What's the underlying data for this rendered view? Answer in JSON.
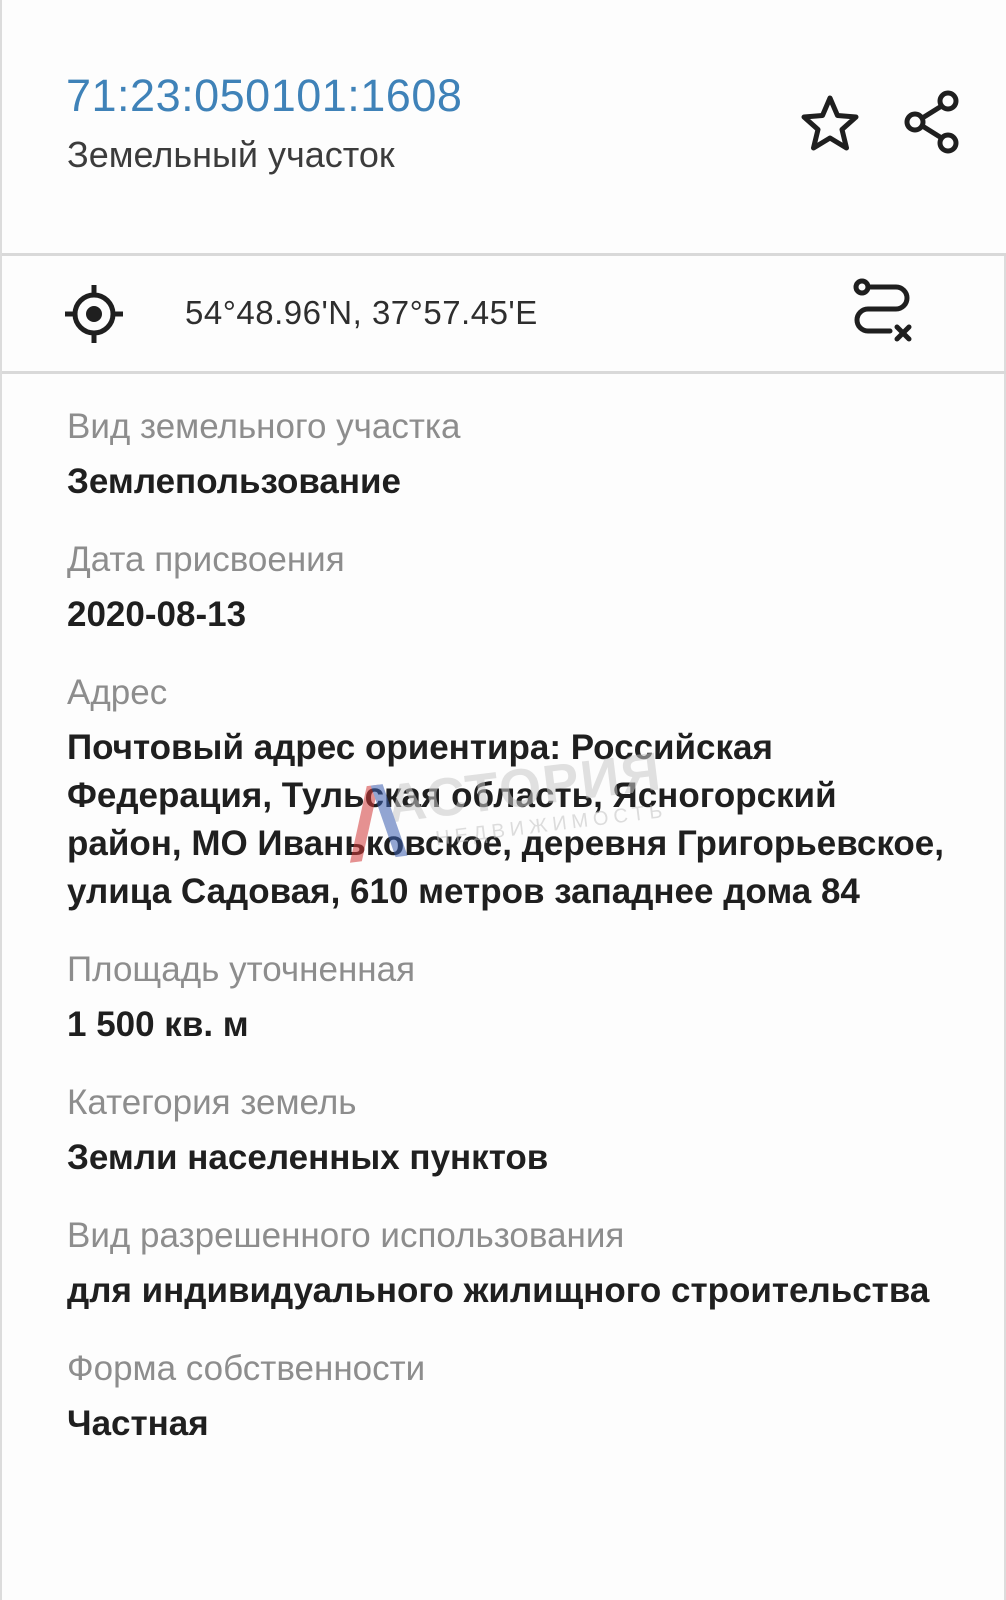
{
  "header": {
    "cadastral_number": "71:23:050101:1608",
    "object_type": "Земельный участок",
    "favorite_icon": "star-outline-icon",
    "share_icon": "share-icon"
  },
  "location": {
    "coordinates": "54°48.96'N, 37°57.45'E",
    "locate_icon": "crosshair-icon",
    "route_icon": "route-icon"
  },
  "fields": [
    {
      "label": "Вид земельного участка",
      "value": "Землепользование"
    },
    {
      "label": "Дата присвоения",
      "value": "2020-08-13"
    },
    {
      "label": "Адрес",
      "value": "Почтовый адрес ориентира: Российская Федерация, Тульская область, Ясногорский район, МО Иваньковское, деревня Григорьевское, улица Садовая, 610 метров западнее дома 84"
    },
    {
      "label": "Площадь уточненная",
      "value": "1 500 кв. м"
    },
    {
      "label": "Категория земель",
      "value": "Земли населенных пунктов"
    },
    {
      "label": "Вид разрешенного использования",
      "value": "для индивидуального жилищного строительства"
    },
    {
      "label": "Форма собственности",
      "value": "Частная"
    }
  ],
  "watermark": {
    "brand": "АСТОРИЯ",
    "tagline": "НЕДВИЖИМОСТЬ"
  },
  "colors": {
    "link": "#3f82b8",
    "label": "#8d8d8d",
    "value": "#1f1f1f",
    "divider": "#d9d9d9",
    "watermark_accent": "#d23a3a"
  }
}
